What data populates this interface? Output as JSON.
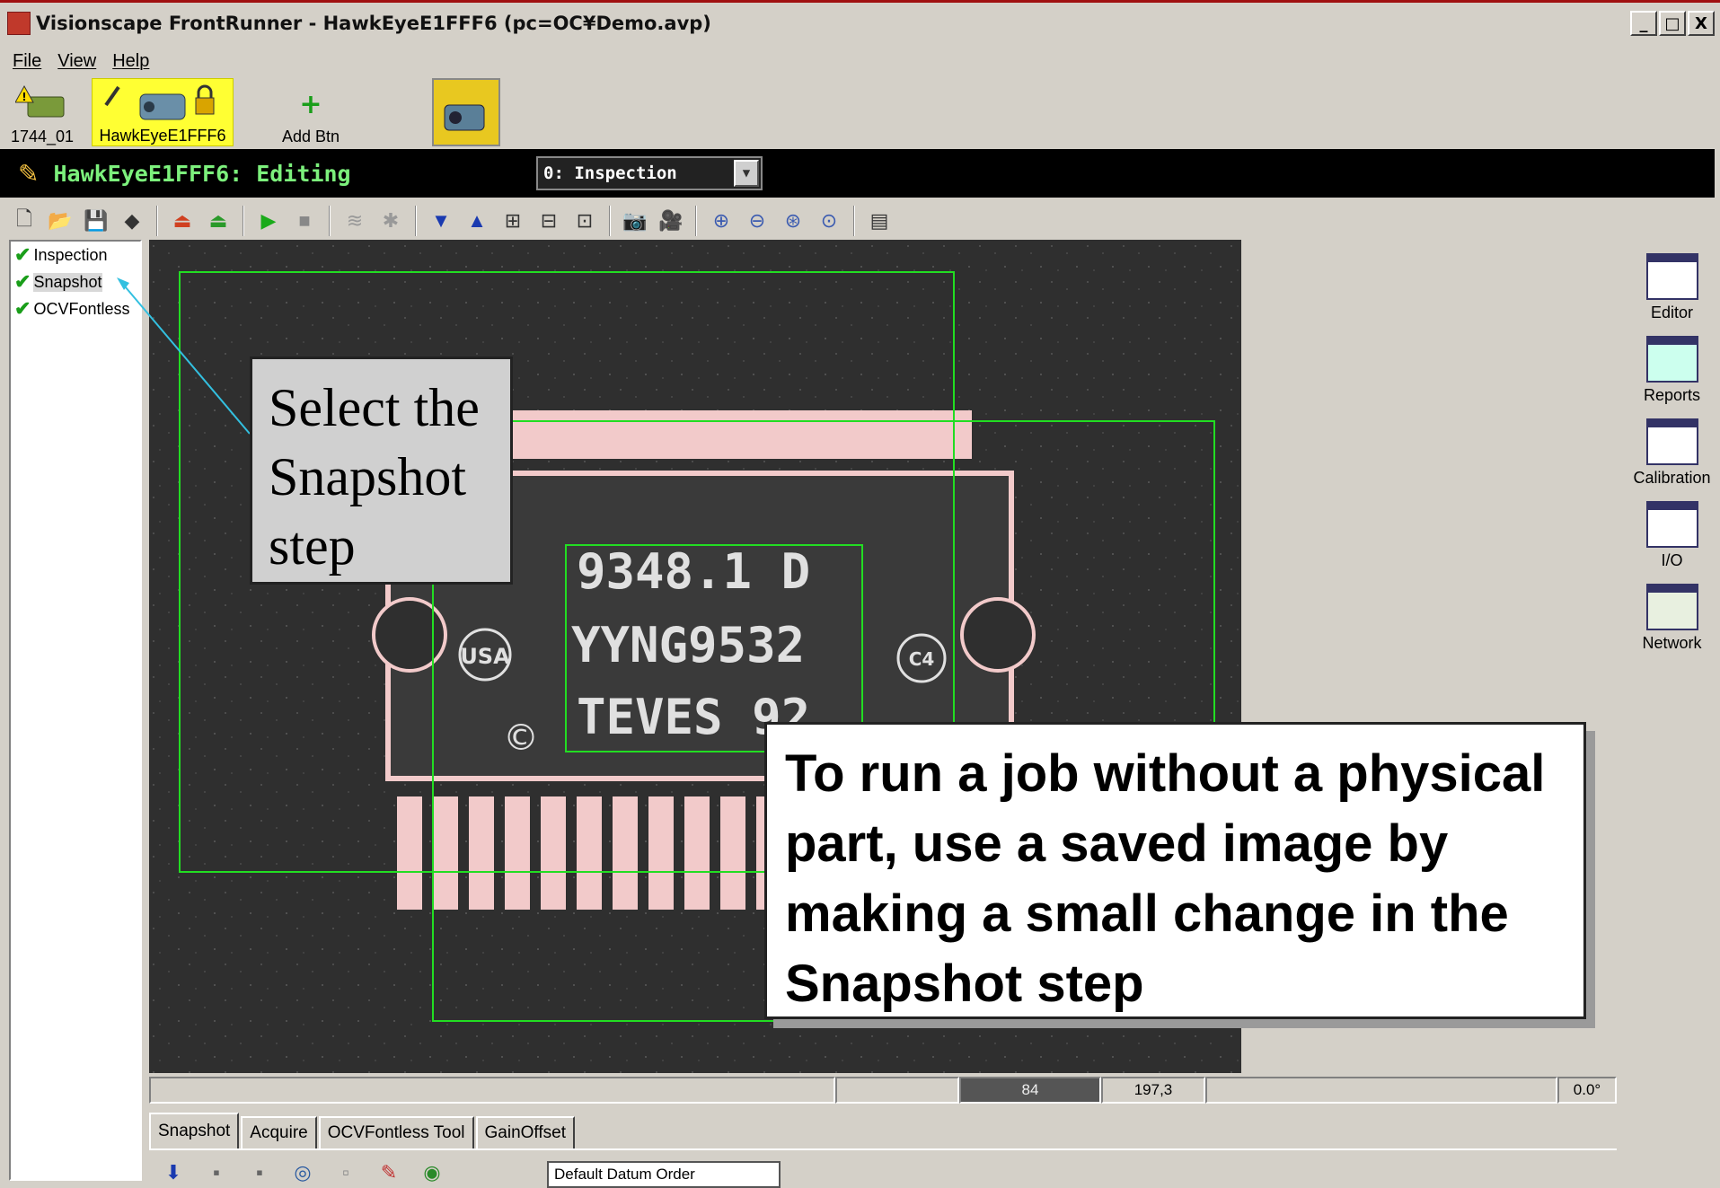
{
  "window": {
    "title": "Visionscape FrontRunner - HawkEyeE1FFF6 (pc=OC¥Demo.avp)",
    "controls": [
      "_",
      "□",
      "X"
    ]
  },
  "menu": [
    "File",
    "View",
    "Help"
  ],
  "devices": {
    "device1_label": "1744_01",
    "device2_label": "HawkEyeE1FFF6",
    "add_label": "Add Btn"
  },
  "editbar": {
    "title": "HawkEyeE1FFF6: Editing",
    "inspection_select": "0: Inspection"
  },
  "tree": [
    {
      "label": "Inspection"
    },
    {
      "label": "Snapshot"
    },
    {
      "label": "OCVFontless"
    }
  ],
  "status": {
    "value1": "84",
    "coords": "197,3",
    "angle": "0.0°"
  },
  "tabs": [
    "Snapshot",
    "Acquire",
    "OCVFontless Tool",
    "GainOffset"
  ],
  "datum_order": "Default Datum Order",
  "right_panel": [
    "Editor",
    "Reports",
    "Calibration",
    "I/O",
    "Network"
  ],
  "image_text": {
    "line1": "9348.1 D",
    "line2": "YYNG9532",
    "line3": "TEVES 92",
    "usa": "USA",
    "c4": "C4",
    "copyright": "©"
  },
  "callouts": {
    "select_step": "Select the Snapshot step",
    "instructions": "To run a job without a physical part, use a saved image by making a small change in the Snapshot step"
  },
  "colors": {
    "title_accent": "#a01010",
    "edit_text": "#7cf07c",
    "highlight_yellow": "#ffff33",
    "roi_green": "#22dd22"
  }
}
